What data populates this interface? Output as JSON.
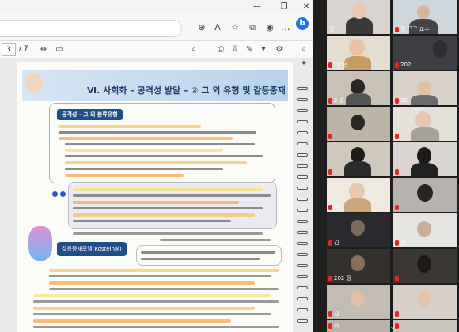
{
  "pdf_viewer": {
    "page_current": "3",
    "page_total": "/ 7"
  },
  "document": {
    "header_title": "Ⅵ. 사회화 – 공격성 발달 – ② 그 외 유형 및 갈등중재",
    "section1_tag": "공격성 - 그 외 분류유형",
    "section2_tag": "갈등중재모델(Kostelnik)"
  },
  "participants": [
    {
      "name": "정",
      "active": true
    },
    {
      "name": "정 ᄀᄀ 교수",
      "active": false
    },
    {
      "name": "20 은",
      "active": false
    },
    {
      "name": "202",
      "active": false
    },
    {
      "name": "2 슬",
      "active": false
    },
    {
      "name": "20",
      "active": false
    },
    {
      "name": "",
      "active": false
    },
    {
      "name": "",
      "active": false
    },
    {
      "name": "",
      "active": false
    },
    {
      "name": "",
      "active": false
    },
    {
      "name": "김",
      "active": false
    },
    {
      "name": "",
      "active": false
    },
    {
      "name": "김",
      "active": false
    },
    {
      "name": "김",
      "active": false
    },
    {
      "name": "202 정",
      "active": false
    },
    {
      "name": "",
      "active": false
    },
    {
      "name": "김",
      "active": false
    },
    {
      "name": "",
      "active": false
    },
    {
      "name": "최",
      "active": false
    },
    {
      "name": "",
      "active": false
    }
  ],
  "colors": {
    "active_speaker": "#7bd23a",
    "muted_mic": "#e22222",
    "doc_tag": "#1f4f8a"
  },
  "icons": [
    "minimize-icon",
    "maximize-icon",
    "close-icon",
    "zoom-icon",
    "read-aloud-icon",
    "favorite-icon",
    "collections-icon",
    "profile-icon",
    "settings-more-icon",
    "edge-sidebar-icon",
    "search-icon",
    "print-icon",
    "save-icon",
    "draw-icon",
    "highlight-icon",
    "chevron-down-icon"
  ]
}
